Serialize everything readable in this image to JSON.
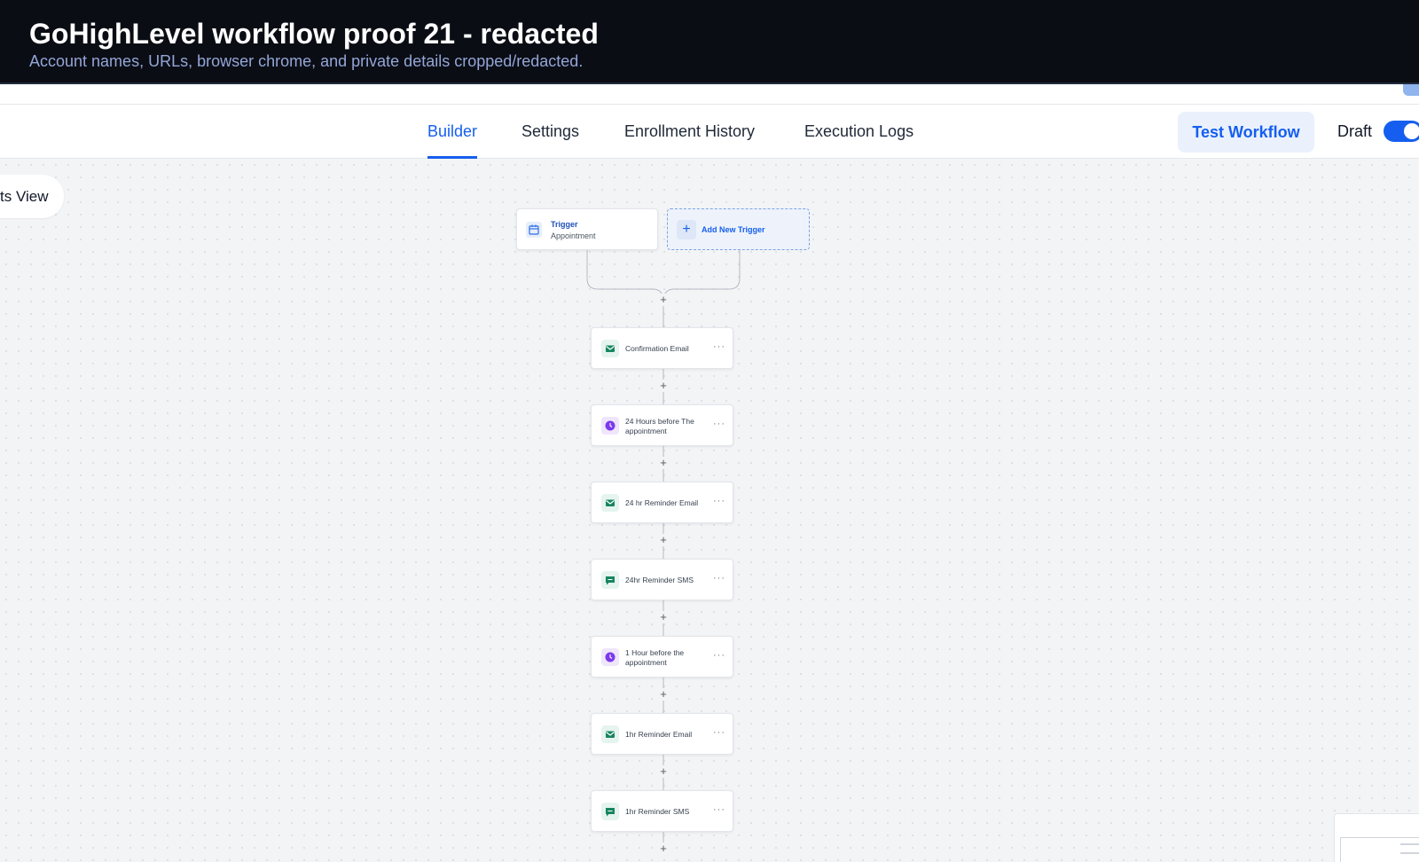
{
  "banner": {
    "title": "GoHighLevel workflow proof 21 - redacted",
    "subtitle": "Account names, URLs, browser chrome, and private details cropped/redacted."
  },
  "nav": {
    "tabs": [
      {
        "label": "Builder",
        "active": true
      },
      {
        "label": "Settings",
        "active": false
      },
      {
        "label": "Enrollment History",
        "active": false
      },
      {
        "label": "Execution Logs",
        "active": false
      }
    ],
    "test_button": "Test Workflow",
    "draft_label": "Draft"
  },
  "canvas": {
    "view_toggle": "ts View",
    "trigger": {
      "title": "Trigger",
      "subtitle": "Appointment"
    },
    "add_trigger": "Add New Trigger",
    "steps": [
      {
        "label": "Confirmation Email",
        "icon": "email-icon"
      },
      {
        "label": "24 Hours before The appointment",
        "icon": "wait-clock-icon"
      },
      {
        "label": "24 hr Reminder Email",
        "icon": "email-icon"
      },
      {
        "label": "24hr Reminder SMS",
        "icon": "sms-icon"
      },
      {
        "label": "1 Hour before the appointment",
        "icon": "wait-clock-icon"
      },
      {
        "label": "1hr Reminder Email",
        "icon": "email-icon"
      },
      {
        "label": "1hr Reminder SMS",
        "icon": "sms-icon"
      }
    ],
    "more_glyph": "···",
    "plus_glyph": "+"
  },
  "colors": {
    "accent": "#155eef",
    "email_icon": "#17855f",
    "wait_icon": "#7c3aed",
    "banner_bg": "#0b0d14"
  }
}
